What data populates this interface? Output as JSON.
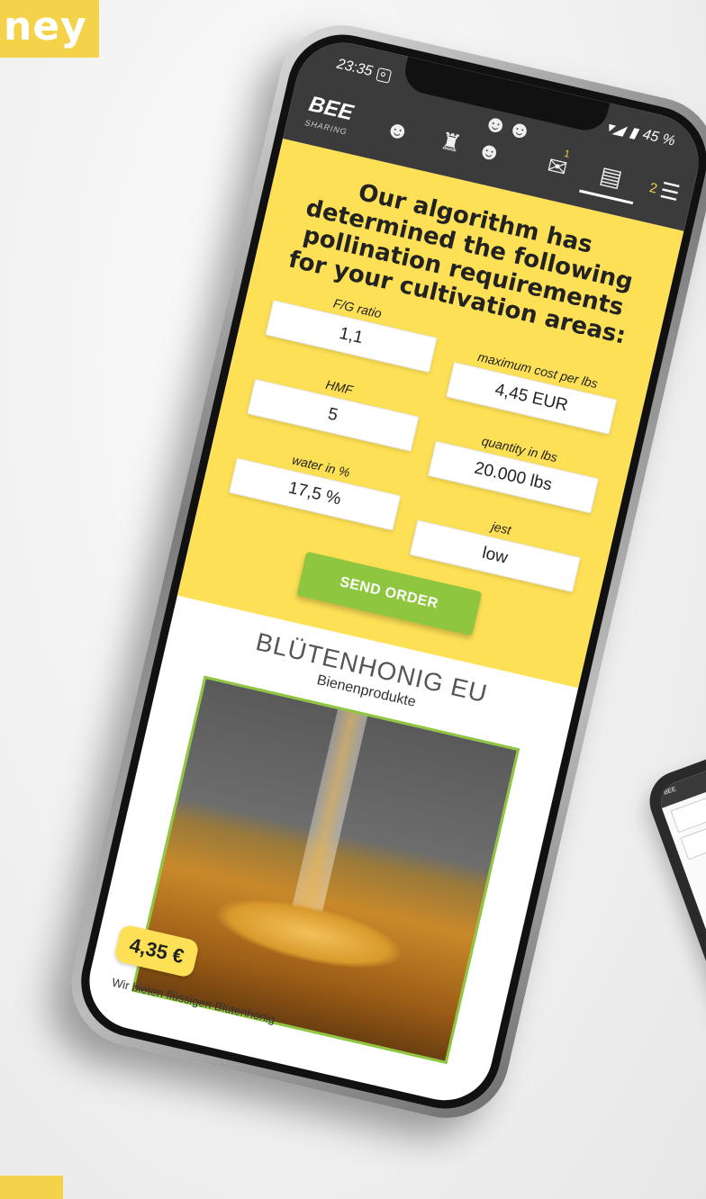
{
  "banner": {
    "text": "ney"
  },
  "status": {
    "time": "23:35",
    "battery": "45 %"
  },
  "logo": {
    "main": "BEE",
    "sub": "SHARING"
  },
  "nav": {
    "items": [
      {
        "icon": "farmer-icon"
      },
      {
        "icon": "beekeeper-icon"
      },
      {
        "icon": "group-icon"
      },
      {
        "icon": "chat-icon",
        "badge": "1"
      },
      {
        "icon": "shop-icon",
        "active": true
      }
    ],
    "menu_count": "2"
  },
  "form": {
    "headline": "Our algorithm has determined the following pollination requirements for your cultivation areas:",
    "fg_ratio_label": "F/G ratio",
    "fg_ratio_value": "1,1",
    "hmf_label": "HMF",
    "hmf_value": "5",
    "water_label": "water in %",
    "water_value": "17,5 %",
    "max_cost_label": "maximum cost per lbs",
    "max_cost_value": "4,45 EUR",
    "quantity_label": "quantity in lbs",
    "quantity_value": "20.000 lbs",
    "jest_label": "jest",
    "jest_value": "low",
    "send_label": "SEND ORDER"
  },
  "product": {
    "title": "BLÜTENHONIG EU",
    "subtitle": "Bienenprodukte",
    "price": "4,35 €",
    "description": "Wir bieten flüssigen Blütenhonig"
  },
  "colors": {
    "yellow": "#fde055",
    "green": "#8ec63f",
    "dark": "#3b3b3b"
  }
}
